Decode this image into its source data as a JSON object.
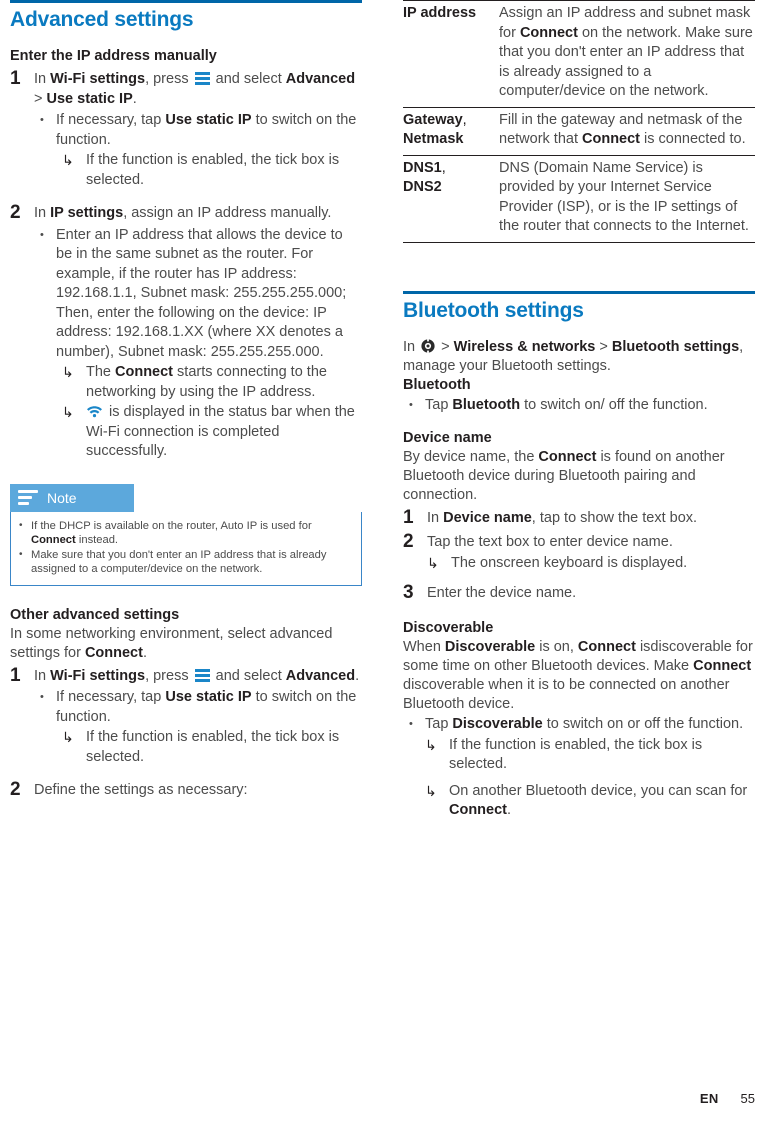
{
  "page": {
    "footer_lang": "EN",
    "footer_page": "55",
    "accent_blue": "#0a7ac0",
    "rule_blue": "#0066a8",
    "note_blue": "#5ca8dc",
    "icon_blue": "#1a86c8",
    "body_gray": "#4c4c4c"
  },
  "left": {
    "section_title": "Advanced settings",
    "sub1": "Enter the IP address manually",
    "step1": {
      "num": "1",
      "line_a_pre": "In ",
      "line_a_bold1": "Wi-Fi settings",
      "line_a_mid": ", press ",
      "line_a_post": " and select ",
      "line_b_bold1": "Advanced",
      "line_b_gt": " > ",
      "line_b_bold2": "Use static IP",
      "line_b_end": ".",
      "bullet": {
        "mark": "•",
        "pre": "If necessary, tap ",
        "bold": "Use static IP",
        "post": " to switch on the function."
      },
      "arrow": {
        "mark": "↳",
        "text": "If the function is enabled, the tick box is selected."
      }
    },
    "step2": {
      "num": "2",
      "pre": "In ",
      "bold": "IP settings",
      "post": ", assign an IP address manually.",
      "bullet": {
        "mark": "•",
        "text": "Enter an IP address that allows the device to be in the same subnet as the router. For example, if the router has IP address: 192.168.1.1, Subnet mask: 255.255.255.000; Then, enter the following on the device: IP address: 192.168.1.XX (where XX denotes a number), Subnet mask: 255.255.255.000."
      },
      "arrow1": {
        "mark": "↳",
        "pre": "The ",
        "bold": "Connect",
        "post": " starts connecting to the networking by using the IP address."
      },
      "arrow2": {
        "mark": "↳",
        "text": " is displayed in the status bar when the Wi-Fi connection is completed successfully."
      }
    },
    "note": {
      "title": "Note",
      "items": [
        {
          "mark": "•",
          "pre": "If the DHCP is available on the router, Auto IP is used for ",
          "bold": "Connect",
          "post": " instead."
        },
        {
          "mark": "•",
          "pre": "Make sure that you don't enter an IP address that is already assigned to a computer/device on the network.",
          "bold": "",
          "post": ""
        }
      ]
    },
    "sub2": "Other advanced settings",
    "intro2_pre": "In some networking environment, select advanced settings for ",
    "intro2_bold": "Connect",
    "intro2_post": ".",
    "step3": {
      "num": "1",
      "line_a_pre": "In ",
      "line_a_bold1": "Wi-Fi settings",
      "line_a_mid": ", press ",
      "line_a_post": " and select ",
      "line_b_bold": "Advanced",
      "line_b_end": ".",
      "bullet": {
        "mark": "•",
        "pre": "If necessary, tap ",
        "bold": "Use static IP",
        "post": " to switch on the function."
      },
      "arrow": {
        "mark": "↳",
        "text": "If the function is enabled, the tick box is selected."
      }
    },
    "step4": {
      "num": "2",
      "text": "Define the settings as necessary:"
    }
  },
  "right": {
    "table": {
      "rows": [
        {
          "key": "IP address",
          "key_suffix": "",
          "key2": "",
          "val_pre": "Assign an IP address and subnet mask for ",
          "val_bold": "Connect",
          "val_post": " on the network. Make sure that you don't enter an IP address that is already assigned to a computer/device on the network."
        },
        {
          "key": "Gateway",
          "key_suffix": ",",
          "key2": "Netmask",
          "val_pre": "Fill in the gateway and netmask of the network that ",
          "val_bold": "Connect",
          "val_post": " is connected to."
        },
        {
          "key": "DNS1",
          "key_suffix": ",",
          "key2": "DNS2",
          "val_pre": "DNS (Domain Name Service) is provided by your Internet Service Provider (ISP), or is the IP settings of the router that connects to the Internet.",
          "val_bold": "",
          "val_post": ""
        }
      ]
    },
    "section_title": "Bluetooth settings",
    "intro": {
      "pre": "In ",
      "gt1": " > ",
      "bold1": "Wireless & networks",
      "gt2": " > ",
      "bold2": "Bluetooth settings",
      "post": ", manage your Bluetooth settings."
    },
    "sub_bluetooth": "Bluetooth",
    "bt_bullet": {
      "mark": "•",
      "pre": "Tap ",
      "bold": "Bluetooth",
      "post": " to switch on/ off the function."
    },
    "sub_device_name": "Device name",
    "device_intro_pre": "By device name, the ",
    "device_intro_bold": "Connect",
    "device_intro_post": " is found on another Bluetooth device during Bluetooth pairing and connection.",
    "dn_step1": {
      "num": "1",
      "pre": "In ",
      "bold": "Device name",
      "post": ", tap to show the text box."
    },
    "dn_step2": {
      "num": "2",
      "text": "Tap the text box to enter device name.",
      "arrow": {
        "mark": "↳",
        "text": "The onscreen keyboard is displayed."
      }
    },
    "dn_step3": {
      "num": "3",
      "text": "Enter the device name."
    },
    "sub_discoverable": "Discoverable",
    "disc_intro_pre": "When ",
    "disc_intro_b1": "Discoverable",
    "disc_intro_mid1": " is on, ",
    "disc_intro_b2": "Connect",
    "disc_intro_mid2": " isdiscoverable for some time on other Bluetooth devices. Make ",
    "disc_intro_b3": "Connect",
    "disc_intro_post": " discoverable when it is to be connected on another Bluetooth device.",
    "disc_bullet": {
      "mark": "•",
      "pre": "Tap ",
      "bold": "Discoverable",
      "post": " to switch on or off the function."
    },
    "disc_arrow1": {
      "mark": "↳",
      "text": "If the function is enabled, the tick box is selected."
    },
    "disc_arrow2": {
      "mark": "↳",
      "pre": "On another Bluetooth device, you can scan for ",
      "bold": "Connect",
      "post": "."
    }
  },
  "icons": {
    "menu": "hamburger-menu-icon",
    "wifi": "wifi-signal-icon",
    "gear": "settings-gear-icon",
    "note": "note-lines-icon"
  }
}
